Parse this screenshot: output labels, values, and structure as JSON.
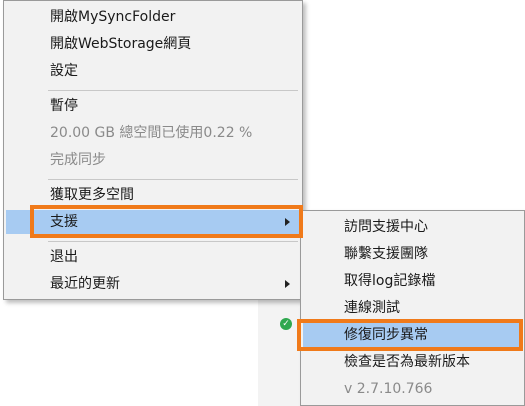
{
  "menu": {
    "items": [
      {
        "label": "開啟MySyncFolder"
      },
      {
        "label": "開啟WebStorage網頁"
      },
      {
        "label": "設定"
      },
      {
        "label": "暫停"
      },
      {
        "label": "20.00 GB 總空間已使用0.22 %"
      },
      {
        "label": "完成同步"
      },
      {
        "label": "獲取更多空間"
      },
      {
        "label": "支援"
      },
      {
        "label": "退出"
      },
      {
        "label": "最近的更新"
      }
    ]
  },
  "submenu": {
    "items": [
      {
        "label": "訪問支援中心"
      },
      {
        "label": "聯繫支援團隊"
      },
      {
        "label": "取得log記錄檔"
      },
      {
        "label": "連線測試"
      },
      {
        "label": "修復同步異常"
      },
      {
        "label": "檢查是否為最新版本"
      },
      {
        "label": "v 2.7.10.766"
      }
    ]
  },
  "tray": {
    "icon": "check-icon",
    "glyph": "✓"
  },
  "colors": {
    "highlight_outline": "#f07a1a",
    "selected_bg": "#a7cbf2",
    "menu_bg": "#f2f2f2",
    "tray_icon": "#2fa84f"
  }
}
